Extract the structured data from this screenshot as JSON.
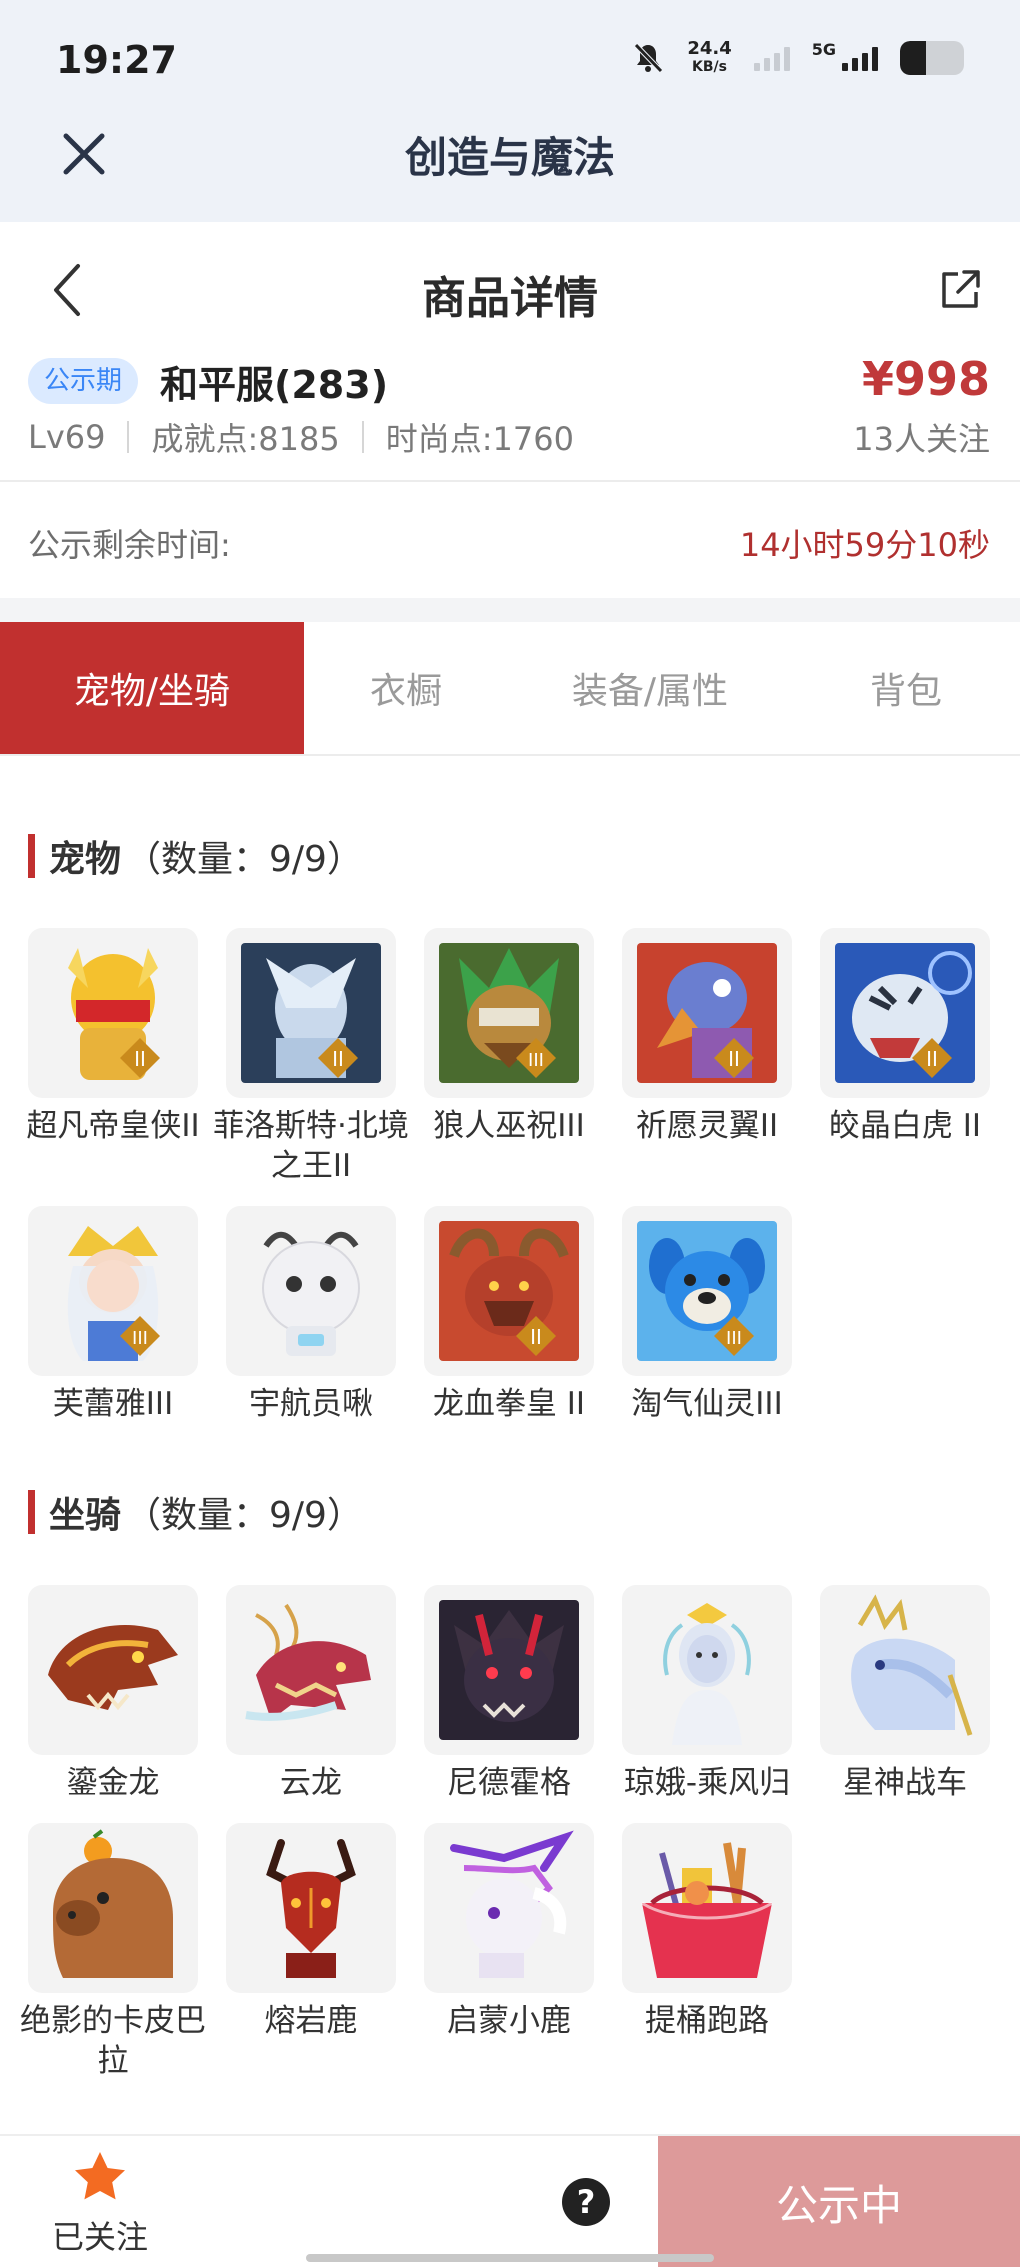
{
  "status_bar": {
    "time": "19:27",
    "speed_value": "24.4",
    "speed_unit": "KB/s",
    "network_label": "5G"
  },
  "app_bar": {
    "title": "创造与魔法"
  },
  "nav": {
    "title": "商品详情"
  },
  "listing": {
    "phase_badge": "公示期",
    "server": "和平服(283)",
    "level": "Lv69",
    "achievement": "成就点:8185",
    "fashion": "时尚点:1760",
    "price": "¥998",
    "followers": "13人关注"
  },
  "remaining": {
    "label": "公示剩余时间:",
    "value": "14小时59分10秒"
  },
  "tabs": [
    {
      "label": "宠物/坐骑",
      "active": true
    },
    {
      "label": "衣橱",
      "active": false
    },
    {
      "label": "装备/属性",
      "active": false
    },
    {
      "label": "背包",
      "active": false
    }
  ],
  "pets": {
    "title": "宠物",
    "count": "（数量：9/9）",
    "items": [
      {
        "name": "超凡帝皇侠II",
        "icon": "golden-armor-hero-icon"
      },
      {
        "name": "菲洛斯特·北境之王II",
        "icon": "ice-king-icon"
      },
      {
        "name": "狼人巫祝III",
        "icon": "werewolf-shaman-icon"
      },
      {
        "name": "祈愿灵翼II",
        "icon": "spirit-bird-icon"
      },
      {
        "name": "皎晶白虎 II",
        "icon": "white-tiger-icon"
      },
      {
        "name": "芙蕾雅III",
        "icon": "freya-icon"
      },
      {
        "name": "宇航员啾",
        "icon": "astronaut-pet-icon"
      },
      {
        "name": "龙血拳皇 II",
        "icon": "dragon-boxer-icon"
      },
      {
        "name": "淘气仙灵III",
        "icon": "naughty-sprite-icon"
      }
    ]
  },
  "mounts": {
    "title": "坐骑",
    "count": "（数量：9/9）",
    "items": [
      {
        "name": "鎏金龙",
        "icon": "gilded-dragon-icon"
      },
      {
        "name": "云龙",
        "icon": "cloud-dragon-icon"
      },
      {
        "name": "尼德霍格",
        "icon": "nidhogg-icon"
      },
      {
        "name": "琼娥-乘风归",
        "icon": "fairy-mount-icon"
      },
      {
        "name": "星神战车",
        "icon": "star-chariot-icon"
      },
      {
        "name": "绝影的卡皮巴拉",
        "icon": "capybara-icon"
      },
      {
        "name": "熔岩鹿",
        "icon": "lava-deer-icon"
      },
      {
        "name": "启蒙小鹿",
        "icon": "fawn-icon"
      },
      {
        "name": "提桶跑路",
        "icon": "bucket-run-icon"
      }
    ]
  },
  "bottom_bar": {
    "follow_label": "已关注",
    "help_glyph": "?",
    "status_button": "公示中"
  },
  "colors": {
    "accent_red": "#c1302f",
    "price_red": "#c0393a",
    "badge_blue": "#3a86f6",
    "status_button_bg": "#dd9a9a",
    "star_orange": "#f36b22"
  }
}
